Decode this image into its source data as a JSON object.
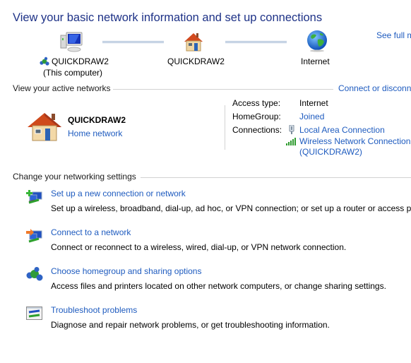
{
  "header": {
    "title": "View your basic network information and set up connections",
    "see_full_map": "See full m"
  },
  "network_map": {
    "nodes": [
      {
        "icon": "computer-icon",
        "label": "QUICKDRAW2",
        "sublabel": "(This computer)"
      },
      {
        "icon": "home-icon",
        "label": "QUICKDRAW2"
      },
      {
        "icon": "globe-icon",
        "label": "Internet"
      }
    ]
  },
  "active_networks": {
    "section_title": "View your active networks",
    "connect_link": "Connect or disconn",
    "network_name": "QUICKDRAW2",
    "network_type": "Home network",
    "details": {
      "access_type_label": "Access type:",
      "access_type_value": "Internet",
      "homegroup_label": "HomeGroup:",
      "homegroup_value": "Joined",
      "connections_label": "Connections:",
      "connections": [
        {
          "icon": "wired-connection-icon",
          "name": "Local Area Connection"
        },
        {
          "icon": "wireless-signal-icon",
          "name": "Wireless Network Connection",
          "sub": "(QUICKDRAW2)"
        }
      ]
    }
  },
  "settings": {
    "section_title": "Change your networking settings",
    "items": [
      {
        "icon": "new-connection-icon",
        "title": "Set up a new connection or network",
        "desc": "Set up a wireless, broadband, dial-up, ad hoc, or VPN connection; or set up a router or access poi"
      },
      {
        "icon": "connect-network-icon",
        "title": "Connect to a network",
        "desc": "Connect or reconnect to a wireless, wired, dial-up, or VPN network connection."
      },
      {
        "icon": "homegroup-icon",
        "title": "Choose homegroup and sharing options",
        "desc": "Access files and printers located on other network computers, or change sharing settings."
      },
      {
        "icon": "troubleshoot-icon",
        "title": "Troubleshoot problems",
        "desc": "Diagnose and repair network problems, or get troubleshooting information."
      }
    ]
  }
}
